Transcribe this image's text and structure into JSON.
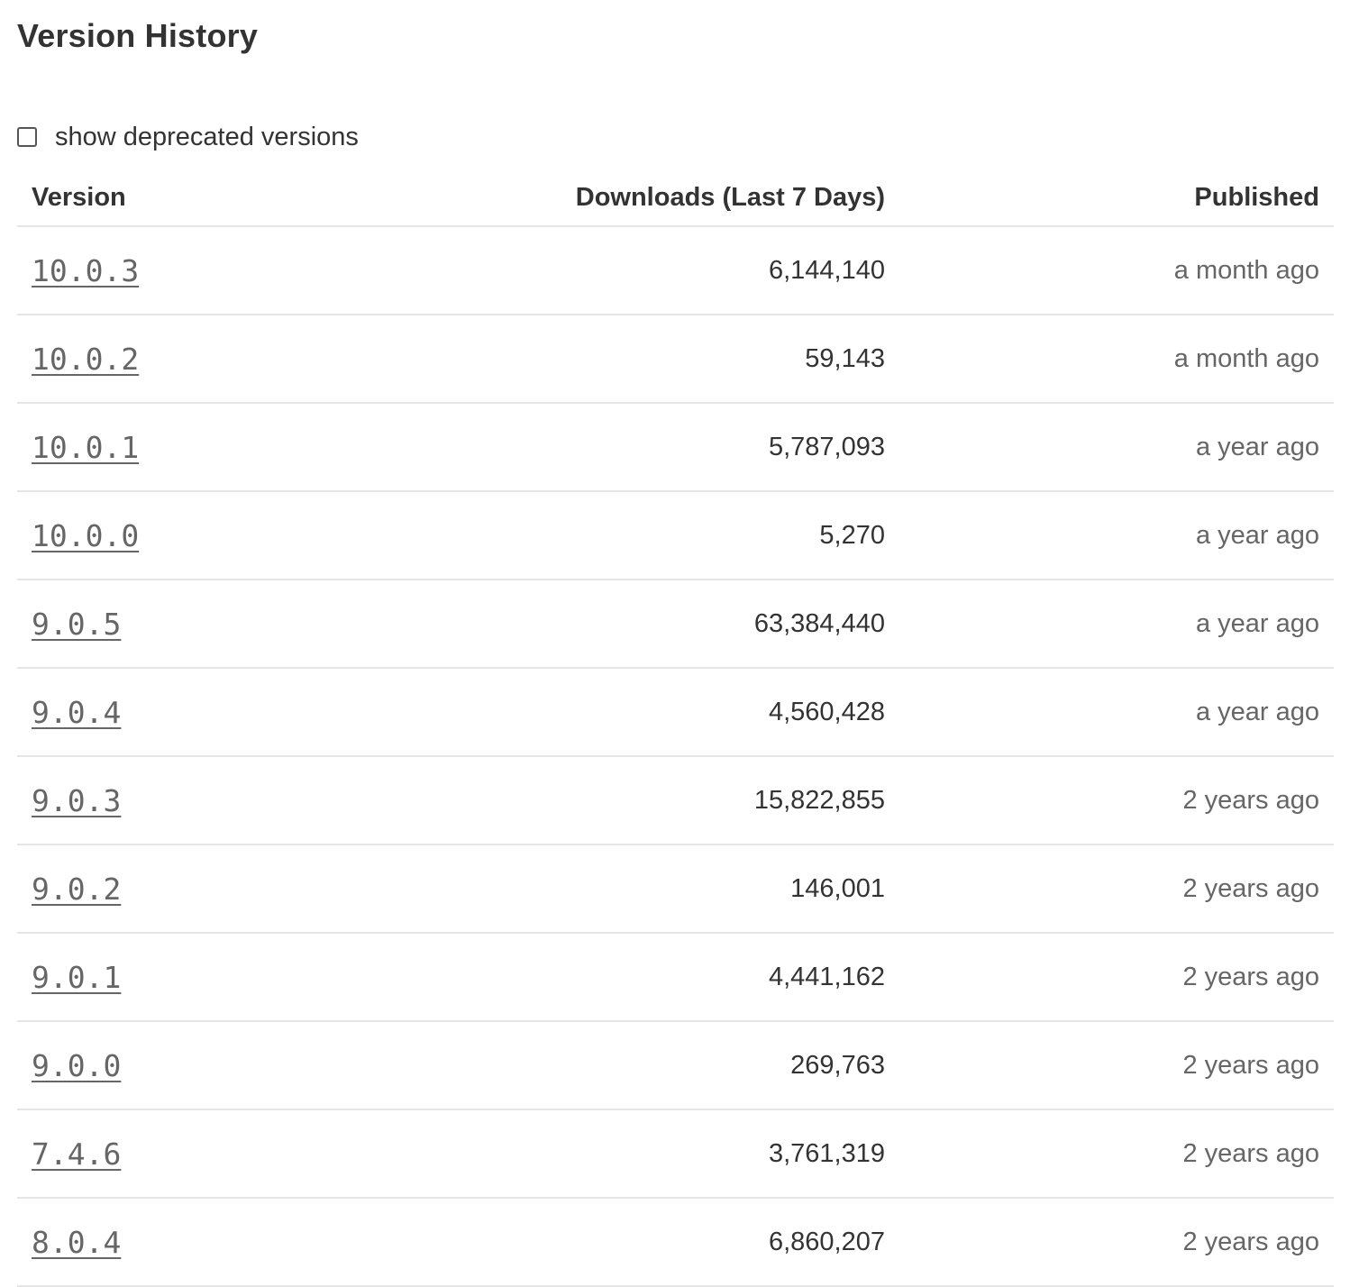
{
  "section": {
    "title": "Version History"
  },
  "filter": {
    "show_deprecated_label": "show deprecated versions",
    "checked": false
  },
  "table": {
    "headers": {
      "version": "Version",
      "downloads": "Downloads (Last 7 Days)",
      "published": "Published"
    },
    "rows": [
      {
        "version": "10.0.3",
        "downloads": "6,144,140",
        "published": "a month ago"
      },
      {
        "version": "10.0.2",
        "downloads": "59,143",
        "published": "a month ago"
      },
      {
        "version": "10.0.1",
        "downloads": "5,787,093",
        "published": "a year ago"
      },
      {
        "version": "10.0.0",
        "downloads": "5,270",
        "published": "a year ago"
      },
      {
        "version": "9.0.5",
        "downloads": "63,384,440",
        "published": "a year ago"
      },
      {
        "version": "9.0.4",
        "downloads": "4,560,428",
        "published": "a year ago"
      },
      {
        "version": "9.0.3",
        "downloads": "15,822,855",
        "published": "2 years ago"
      },
      {
        "version": "9.0.2",
        "downloads": "146,001",
        "published": "2 years ago"
      },
      {
        "version": "9.0.1",
        "downloads": "4,441,162",
        "published": "2 years ago"
      },
      {
        "version": "9.0.0",
        "downloads": "269,763",
        "published": "2 years ago"
      },
      {
        "version": "7.4.6",
        "downloads": "3,761,319",
        "published": "2 years ago"
      },
      {
        "version": "8.0.4",
        "downloads": "6,860,207",
        "published": "2 years ago"
      }
    ]
  }
}
